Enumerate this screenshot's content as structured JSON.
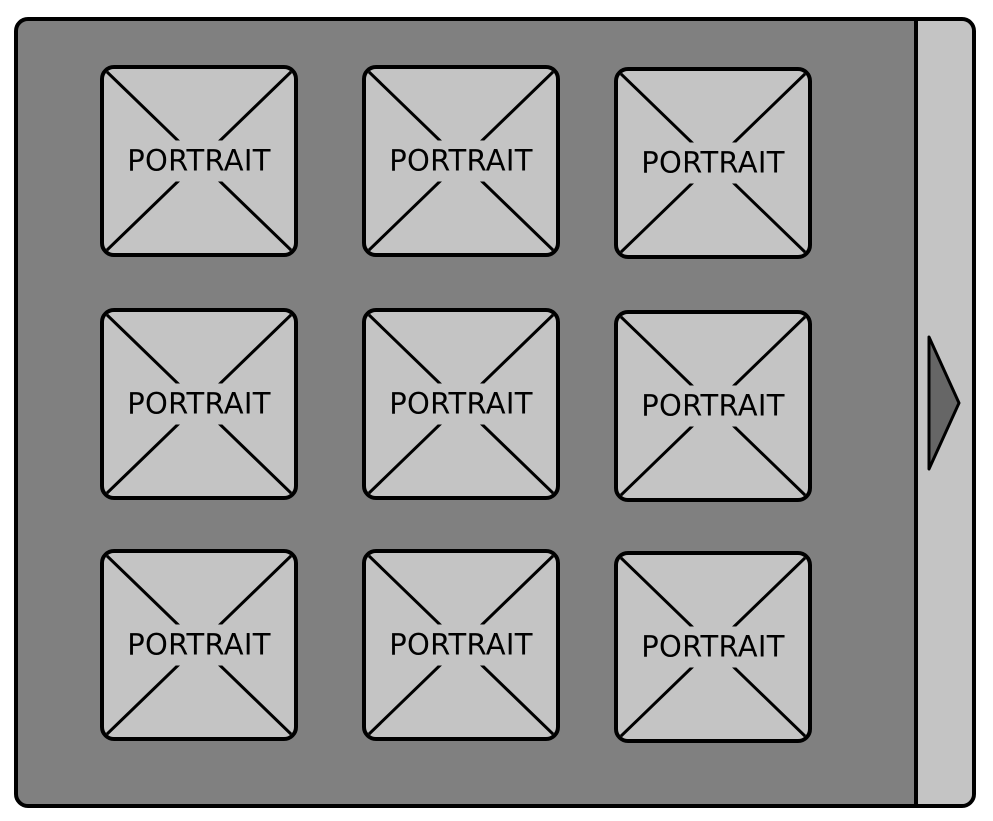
{
  "gallery": {
    "portraits": [
      {
        "label": "PORTRAIT"
      },
      {
        "label": "PORTRAIT"
      },
      {
        "label": "PORTRAIT"
      },
      {
        "label": "PORTRAIT"
      },
      {
        "label": "PORTRAIT"
      },
      {
        "label": "PORTRAIT"
      },
      {
        "label": "PORTRAIT"
      },
      {
        "label": "PORTRAIT"
      },
      {
        "label": "PORTRAIT"
      }
    ],
    "next_icon": "chevron-right-icon"
  },
  "colors": {
    "panel_background": "#808080",
    "tile_background": "#c4c4c4",
    "side_tab_background": "#c4c4c4",
    "arrow_fill": "#666666",
    "outline": "#000000"
  }
}
